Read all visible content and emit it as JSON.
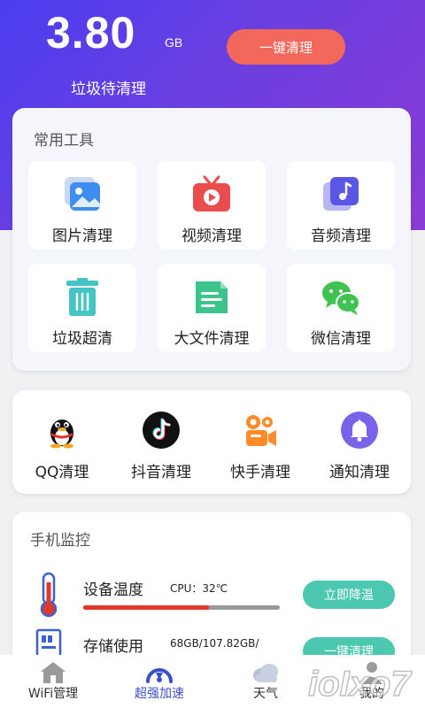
{
  "header": {
    "storage_value": "3.80",
    "storage_unit": "GB",
    "subtitle": "垃圾待清理",
    "clean_button": "一键清理"
  },
  "tools": {
    "title": "常用工具",
    "items": [
      {
        "label": "图片清理",
        "icon": "image-icon"
      },
      {
        "label": "视频清理",
        "icon": "video-icon"
      },
      {
        "label": "音频清理",
        "icon": "music-icon"
      },
      {
        "label": "垃圾超清",
        "icon": "trash-icon"
      },
      {
        "label": "大文件清理",
        "icon": "file-icon"
      },
      {
        "label": "微信清理",
        "icon": "wechat-icon"
      }
    ]
  },
  "apps": {
    "items": [
      {
        "label": "QQ清理",
        "icon": "qq-icon"
      },
      {
        "label": "抖音清理",
        "icon": "tiktok-icon"
      },
      {
        "label": "快手清理",
        "icon": "kuaishou-icon"
      },
      {
        "label": "通知清理",
        "icon": "bell-icon"
      }
    ]
  },
  "monitor": {
    "title": "手机监控",
    "rows": [
      {
        "name": "设备温度",
        "info": "CPU：32℃",
        "button": "立即降温",
        "level": 0.64,
        "icon": "thermometer-icon"
      },
      {
        "name": "存储使用",
        "info": "68GB/107.82GB/",
        "button": "一键清理",
        "icon": "storage-icon"
      }
    ]
  },
  "tabbar": {
    "items": [
      {
        "label": "WiFi管理",
        "icon": "home-icon"
      },
      {
        "label": "超强加速",
        "icon": "speed-icon",
        "active": true
      },
      {
        "label": "天气",
        "icon": "cloud-icon"
      },
      {
        "label": "我的",
        "icon": "user-icon"
      }
    ]
  },
  "watermark": {
    "text": "ioIxo7"
  },
  "colors": {
    "hero_start": "#4a3ef0",
    "hero_end": "#8a3bd6",
    "clean_button": "#f2685a",
    "action_button": "#4cc7b0",
    "temperature_bar": "#e0382c"
  }
}
